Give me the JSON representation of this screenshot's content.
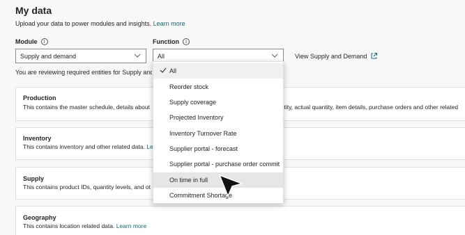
{
  "header": {
    "title": "My data",
    "subtitle": "Upload your data to power modules and insights.",
    "learn_more": "Learn more"
  },
  "module": {
    "label": "Module",
    "value": "Supply and demand"
  },
  "function": {
    "label": "Function",
    "value": "All"
  },
  "view_link": "View Supply and Demand",
  "review_text": "You are reviewing required entities for Supply and Demand",
  "cards": [
    {
      "title": "Production",
      "desc_left": "This contains the master schedule, details about",
      "desc_right": "antity, actual quantity, item details, purchase orders and other related"
    },
    {
      "title": "Inventory",
      "desc_left": "This contains inventory and other related data.",
      "link": "Le"
    },
    {
      "title": "Supply",
      "desc_left": "This contains product IDs, quantity levels, and ot"
    },
    {
      "title": "Geography",
      "desc_left": "This contains location related data.",
      "link": "Learn more"
    }
  ],
  "dropdown": {
    "options": [
      {
        "label": "All",
        "selected": true
      },
      {
        "label": "Reorder stock"
      },
      {
        "label": "Supply coverage"
      },
      {
        "label": "Projected Inventory"
      },
      {
        "label": "Inventory Turnover Rate"
      },
      {
        "label": "Supplier portal - forecast"
      },
      {
        "label": "Supplier portal - purchase order commit"
      },
      {
        "label": "On time in full",
        "hover": true
      },
      {
        "label": "Commitment Shortage"
      }
    ]
  },
  "icons": {
    "info": "info-icon",
    "chevron": "chevron-down-icon",
    "external": "external-link-icon",
    "check": "checkmark-icon",
    "cursor": "mouse-pointer-icon"
  }
}
